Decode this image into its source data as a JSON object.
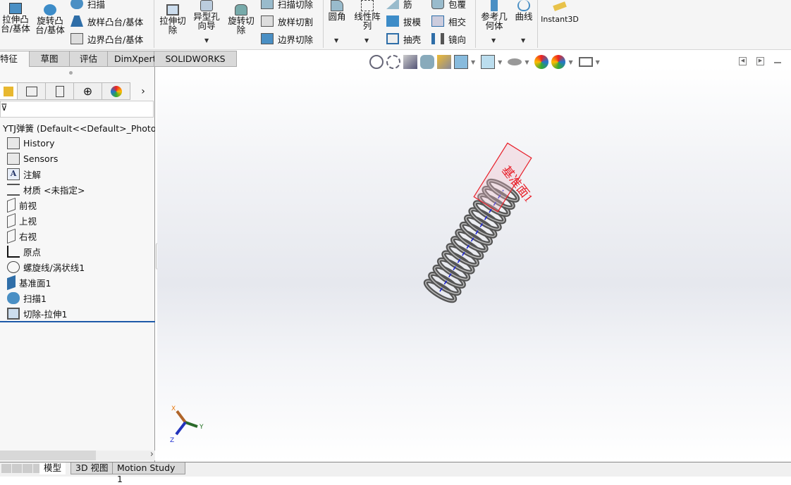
{
  "ribbon": {
    "extrude_boss": "拉伸凸台/基体",
    "revolve_boss": "旋转凸台/基体",
    "sweep": "扫描",
    "loft_boss": "放样凸台/基体",
    "boundary_boss": "边界凸台/基体",
    "extrude_cut": "拉伸切除",
    "hole_wizard": "异型孔向导",
    "revolve_cut": "旋转切除",
    "swept_cut": "扫描切除",
    "loft_cut": "放样切割",
    "boundary_cut": "边界切除",
    "fillet": "圆角",
    "linear_pattern": "线性阵列",
    "rib": "筋",
    "draft": "拔模",
    "shell": "抽壳",
    "wrap": "包覆",
    "intersect": "相交",
    "mirror": "镜向",
    "ref_geometry": "参考几何体",
    "curves": "曲线",
    "instant3d": "Instant3D"
  },
  "tabs": [
    "特征",
    "草图",
    "评估",
    "DimXpert",
    "SOLIDWORKS 插件"
  ],
  "tree": {
    "root": "YTJ弹簧  (Default<<Default>_PhotoV",
    "items": [
      "History",
      "Sensors",
      "注解",
      "材质 <未指定>",
      "前视",
      "上视",
      "右视",
      "原点",
      "螺旋线/涡状线1",
      "基准面1",
      "扫描1",
      "切除-拉伸1"
    ]
  },
  "viewport": {
    "plane_label": "基准面1",
    "triad": {
      "x": "X",
      "y": "Y",
      "z": "Z"
    }
  },
  "bottom_tabs": [
    "模型",
    "3D 视图",
    "Motion Study 1"
  ],
  "colors": {
    "accent": "#1e5aa8",
    "plane": "#e8202a",
    "spring": "#555555"
  }
}
